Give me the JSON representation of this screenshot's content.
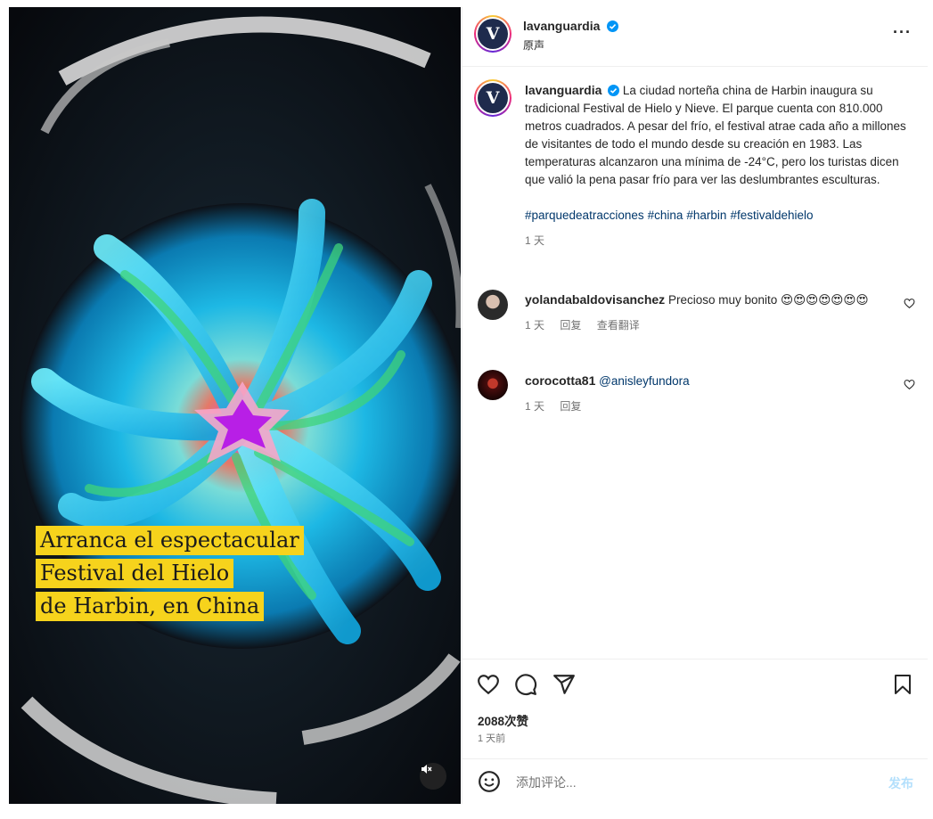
{
  "post": {
    "username": "lavanguardia",
    "logo_letter": "V",
    "location": "原声",
    "more_label": "···"
  },
  "media": {
    "caption_lines": [
      "Arranca el espectacular",
      "Festival del Hielo",
      "de Harbin, en China"
    ],
    "mute_icon": "speaker-muted-icon"
  },
  "caption": {
    "username": "lavanguardia",
    "text": "La ciudad norteña china de Harbin inaugura su tradicional Festival de Hielo y Nieve. El parque cuenta con 810.000 metros cuadrados. A pesar del frío, el festival atrae cada año a millones de visitantes de todo el mundo desde su creación en 1983. Las temperaturas alcanzaron una mínima de -24°C, pero los turistas dicen que valió la pena pasar frío para ver las deslumbrantes esculturas.",
    "hashtags": [
      "#parquedeatracciones",
      "#china",
      "#harbin",
      "#festivaldehielo"
    ],
    "time": "1 天"
  },
  "comments": [
    {
      "username": "yolandabaldovisanchez",
      "text": "Precioso muy bonito",
      "emoji": "😍😍😍😍😍😍😍",
      "time": "1 天",
      "reply": "回复",
      "translate": "查看翻译"
    },
    {
      "username": "corocotta81",
      "mention": "@anisleyfundora",
      "time": "1 天",
      "reply": "回复"
    }
  ],
  "stats": {
    "likes": "2088次赞",
    "time_ago": "1 天前"
  },
  "composer": {
    "placeholder": "添加评论...",
    "post_label": "发布"
  },
  "colors": {
    "link": "#00376b",
    "caption_bg": "#f6d31c",
    "post_disabled": "#b2dffc",
    "verified": "#0095f6"
  }
}
